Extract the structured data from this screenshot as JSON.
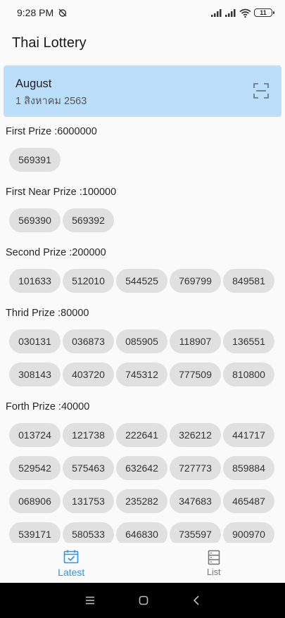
{
  "status_bar": {
    "time": "9:28 PM",
    "battery": "11"
  },
  "app": {
    "title": "Thai Lottery"
  },
  "banner": {
    "month": "August",
    "date": "1 สิงหาคม 2563"
  },
  "sections": [
    {
      "title": "First Prize :6000000",
      "numbers": [
        "569391"
      ]
    },
    {
      "title": "First Near Prize :100000",
      "numbers": [
        "569390",
        "569392"
      ]
    },
    {
      "title": "Second Prize :200000",
      "numbers": [
        "101633",
        "512010",
        "544525",
        "769799",
        "849581"
      ]
    },
    {
      "title": "Thrid Prize :80000",
      "numbers": [
        "030131",
        "036873",
        "085905",
        "118907",
        "136551",
        "308143",
        "403720",
        "745312",
        "777509",
        "810800"
      ]
    },
    {
      "title": "Forth Prize :40000",
      "numbers": [
        "013724",
        "121738",
        "222641",
        "326212",
        "441717",
        "529542",
        "575463",
        "632642",
        "727773",
        "859884",
        "068906",
        "131753",
        "235282",
        "347683",
        "465487",
        "539171",
        "580533",
        "646830",
        "735597",
        "900970",
        "",
        "",
        "",
        "",
        ""
      ]
    }
  ],
  "bottom_nav": {
    "latest_label": "Latest",
    "list_label": "List"
  },
  "colors": {
    "accent": "#2196f3",
    "banner": "#bbdefb",
    "chip": "#e0e0e0"
  },
  "icons": {
    "banner": "scan-icon",
    "latest": "calendar-check-icon",
    "list": "server-list-icon"
  }
}
